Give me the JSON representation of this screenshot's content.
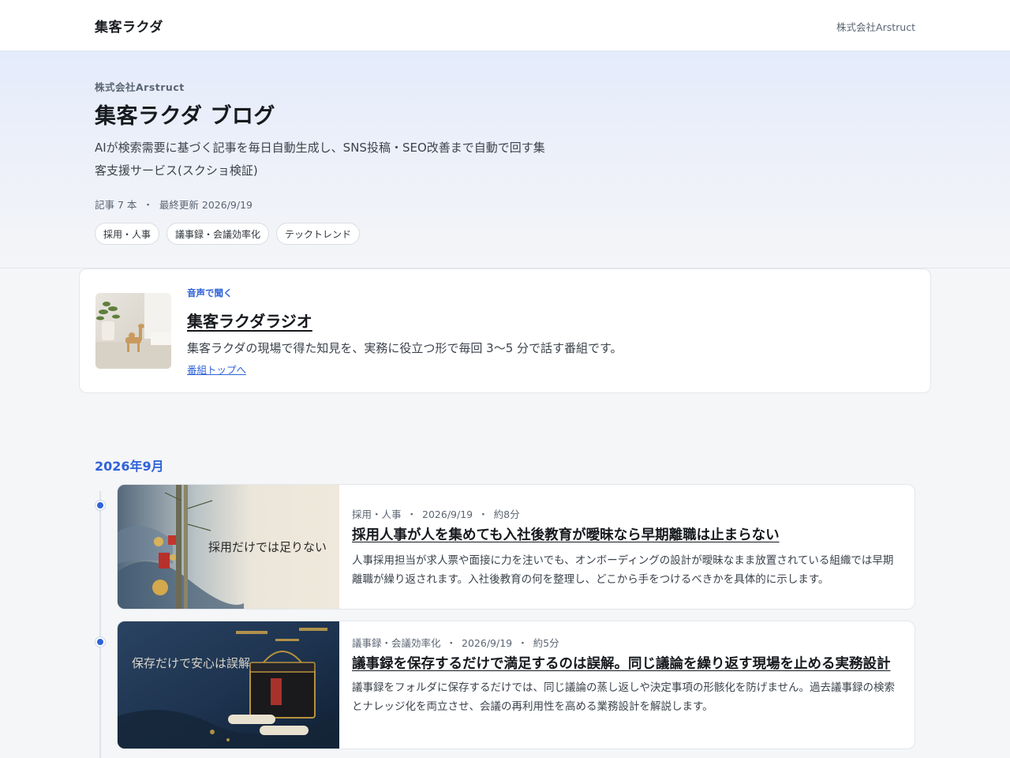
{
  "nav": {
    "brand": "集客ラクダ",
    "company_link": "株式会社Arstruct"
  },
  "hero": {
    "eyebrow": "株式会社Arstruct",
    "title": "集客ラクダ ブログ",
    "description": "AIが検索需要に基づく記事を毎日自動生成し、SNS投稿・SEO改善まで自動で回す集客支援サービス(スクショ検証)",
    "meta_count": "記事 7 本",
    "meta_sep": "・",
    "meta_updated": "最終更新 2026/9/19",
    "tags": [
      "採用・人事",
      "議事録・会議効率化",
      "テックトレンド"
    ]
  },
  "radio": {
    "label": "音声で聞く",
    "title": "集客ラクダラジオ",
    "description": "集客ラクダの現場で得た知見を、実務に役立つ形で毎回 3〜5 分で話す番組です。",
    "link": "番組トップへ"
  },
  "timeline": {
    "month": "2026年9月",
    "posts": [
      {
        "category": "採用・人事",
        "date": "2026/9/19",
        "read_time": "約8分",
        "title": "採用人事が人を集めても入社後教育が曖昧なら早期離職は止まらない",
        "excerpt": "人事採用担当が求人票や面接に力を注いでも、オンボーディングの設計が曖昧なまま放置されている組織では早期離職が繰り返されます。入社後教育の何を整理し、どこから手をつけるべきかを具体的に示します。",
        "thumb_caption": "採用だけでは足りない"
      },
      {
        "category": "議事録・会議効率化",
        "date": "2026/9/19",
        "read_time": "約5分",
        "title": "議事録を保存するだけで満足するのは誤解。同じ議論を繰り返す現場を止める実務設計",
        "excerpt": "議事録をフォルダに保存するだけでは、同じ議論の蒸し返しや決定事項の形骸化を防げません。過去議事録の検索とナレッジ化を両立させ、会議の再利用性を高める業務設計を解説します。",
        "thumb_caption": "保存だけで安心は誤解"
      }
    ],
    "meta_sep": "・"
  },
  "colors": {
    "accent": "#2f63d8",
    "text": "#16191d",
    "muted": "#5b6573"
  }
}
